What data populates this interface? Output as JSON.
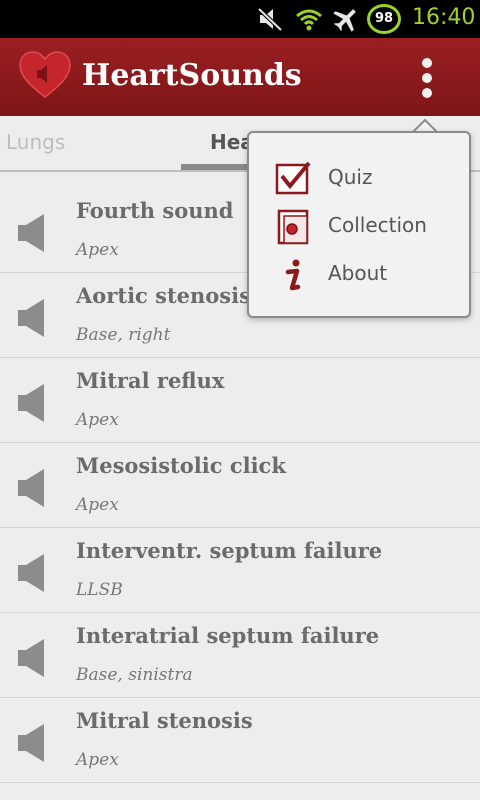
{
  "status_bar": {
    "battery_level": "98",
    "time": "16:40",
    "icons": [
      "mute-icon",
      "wifi-icon",
      "airplane-icon",
      "battery-icon"
    ]
  },
  "app": {
    "title": "HeartSounds",
    "brand_color": "#8c1a1d",
    "logo_icon": "heart-speaker-icon"
  },
  "tabs": [
    {
      "label": "Lungs",
      "selected": false
    },
    {
      "label": "Hea",
      "selected": true
    }
  ],
  "sounds": [
    {
      "title": "Fourth sound",
      "location": "Apex"
    },
    {
      "title": "Aortic stenosis",
      "location": "Base, right"
    },
    {
      "title": "Mitral reflux",
      "location": "Apex"
    },
    {
      "title": "Mesosistolic click",
      "location": "Apex"
    },
    {
      "title": "Interventr. septum failure",
      "location": "LLSB"
    },
    {
      "title": "Interatrial septum failure",
      "location": "Base, sinistra"
    },
    {
      "title": "Mitral stenosis",
      "location": "Apex"
    }
  ],
  "menu": {
    "items": [
      {
        "label": "Quiz",
        "icon": "checkbox-icon"
      },
      {
        "label": "Collection",
        "icon": "cabinet-icon"
      },
      {
        "label": "About",
        "icon": "info-icon"
      }
    ]
  }
}
